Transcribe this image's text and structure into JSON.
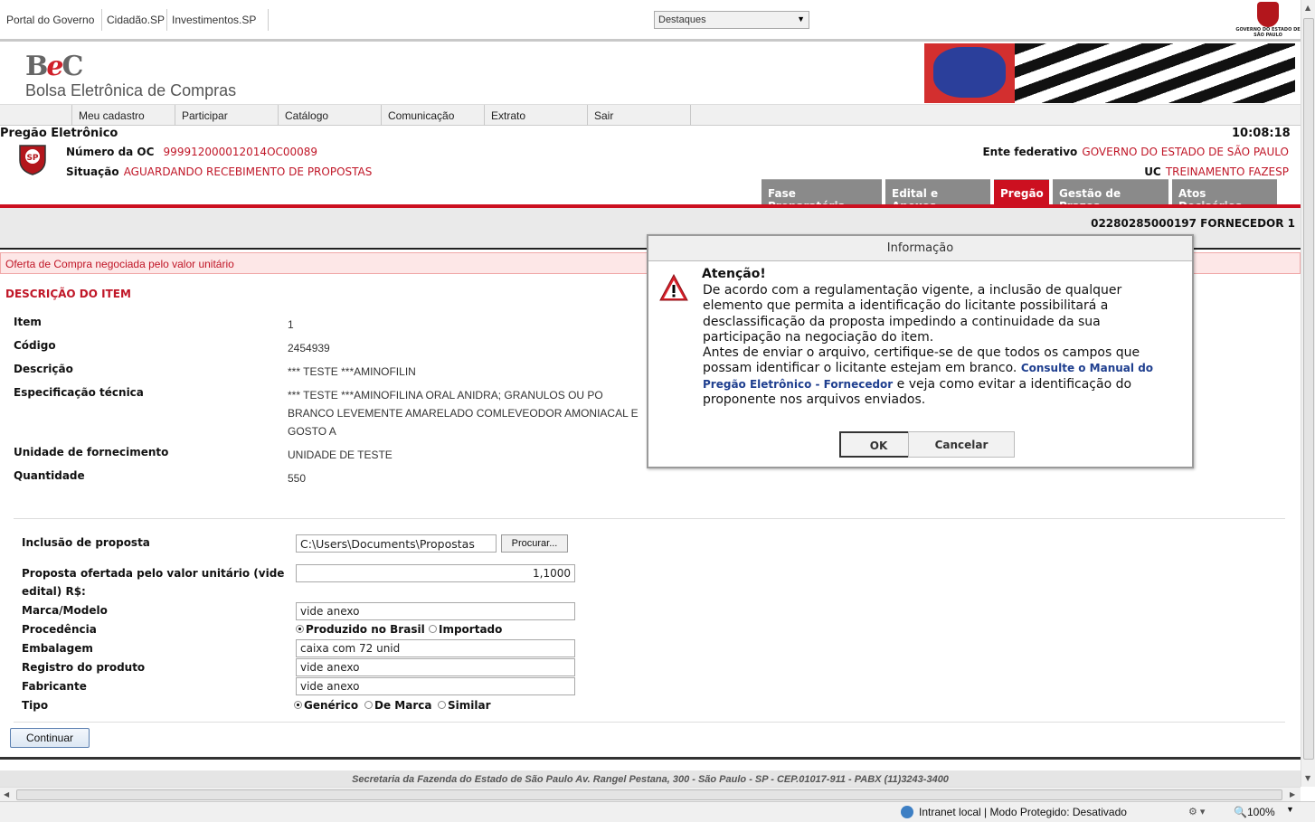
{
  "gov_bar": {
    "links": [
      "Portal do Governo",
      "Cidadão.SP",
      "Investimentos.SP"
    ],
    "destaques": "Destaques",
    "gov_logo_text": "GOVERNO DO ESTADO DE SÃO PAULO"
  },
  "header": {
    "logo_text_b": "B",
    "logo_text_e": "e",
    "logo_text_c": "C",
    "title": "Bolsa Eletrônica de Compras"
  },
  "menu": [
    "Meu cadastro",
    "Participar",
    "Catálogo",
    "Comunicação",
    "Extrato",
    "Sair"
  ],
  "procurement": {
    "heading": "Pregão Eletrônico",
    "time": "10:08:18",
    "oc_label": "Número da OC",
    "oc_value": "999912000012014OC00089",
    "situacao_label": "Situação",
    "situacao_value": "AGUARDANDO RECEBIMENTO DE PROPOSTAS",
    "ente_label": "Ente federativo",
    "ente_value": "GOVERNO DO ESTADO DE SÃO PAULO",
    "uc_label": "UC",
    "uc_value": "TREINAMENTO FAZESP",
    "seal_text": "SP"
  },
  "tabs": [
    {
      "label": "Fase Preparatória",
      "active": false
    },
    {
      "label": "Edital e Anexos",
      "active": false
    },
    {
      "label": "Pregão",
      "active": true
    },
    {
      "label": "Gestão de Prazos",
      "active": false
    },
    {
      "label": "Atos Decisórios",
      "active": false
    }
  ],
  "supplier": "02280285000197 FORNECEDOR 1",
  "offer_notice": "Oferta de Compra negociada pelo valor unitário",
  "item": {
    "section_title": "DESCRIÇÃO DO ITEM",
    "item_label": "Item",
    "item_value": "1",
    "codigo_label": "Código",
    "codigo_value": "2454939",
    "descricao_label": "Descrição",
    "descricao_value": "*** TESTE ***AMINOFILIN",
    "espec_label": "Especificação técnica",
    "espec_line1": "*** TESTE ***AMINOFILINA ORAL ANIDRA; GRANULOS OU PO",
    "espec_line2": "BRANCO LEVEMENTE AMARELADO COMLEVEODOR AMONIACAL E",
    "espec_line3": "GOSTO A",
    "unidade_label": "Unidade de fornecimento",
    "unidade_value": "UNIDADE DE TESTE",
    "quantidade_label": "Quantidade",
    "quantidade_value": "550"
  },
  "form": {
    "inclusao_label": "Inclusão de proposta",
    "inclusao_value": "C:\\Users\\Documents\\Propostas",
    "procurar": "Procurar...",
    "proposta_label_1": "Proposta ofertada pelo valor unitário (vide",
    "proposta_label_2": "edital) R$:",
    "proposta_value": "1,1000",
    "marca_label": "Marca/Modelo",
    "marca_value": "vide anexo",
    "procedencia_label": "Procedência",
    "procedencia_options": [
      "Produzido no Brasil",
      "Importado"
    ],
    "procedencia_selected": "Produzido no Brasil",
    "embalagem_label": "Embalagem",
    "embalagem_value": "caixa com 72 unid",
    "registro_label": "Registro do produto",
    "registro_value": "vide anexo",
    "fabricante_label": "Fabricante",
    "fabricante_value": "vide anexo",
    "tipo_label": "Tipo",
    "tipo_options": [
      "Genérico",
      "De Marca",
      "Similar"
    ],
    "tipo_selected": "Genérico",
    "continuar": "Continuar"
  },
  "footer": "Secretaria da Fazenda do Estado de São Paulo Av. Rangel Pestana, 300 - São Paulo - SP - CEP.01017-911 - PABX (11)3243-3400",
  "status_bar": {
    "zone": "Intranet local | Modo Protegido: Desativado",
    "zoom": "100%"
  },
  "dialog": {
    "title": "Informação",
    "attention": "Atenção!",
    "msg1": "De acordo com a regulamentação vigente, a inclusão de qualquer elemento que permita a identificação do licitante possibilitará a desclassificação da proposta impedindo a continuidade da sua participação na negociação do item.",
    "msg2_pre": "Antes de enviar o arquivo, certifique-se de que todos os campos que possam identificar o licitante estejam em branco. ",
    "msg2_link": "Consulte o Manual do Pregão Eletrônico - Fornecedor",
    "msg2_post": " e veja como evitar a identificação do proponente nos arquivos enviados.",
    "ok": "OK",
    "cancel": "Cancelar"
  },
  "colors": {
    "accent_red": "#cc1020",
    "value_red": "#c01627",
    "tab_gray": "#8a8a8a",
    "link_blue": "#1f3f8f"
  }
}
